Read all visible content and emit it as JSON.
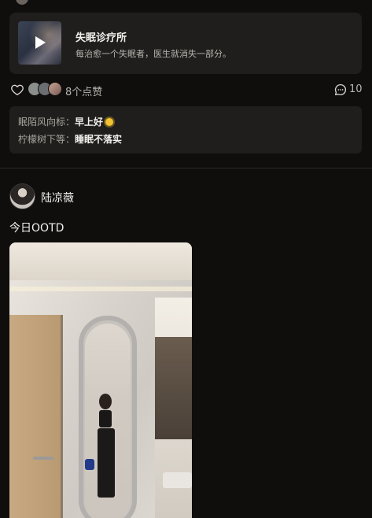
{
  "music_card": {
    "title": "失眠诊疗所",
    "description": "每治愈一个失眠者，医生就消失一部分。"
  },
  "actions": {
    "like_count_label": "8个点赞",
    "comment_count": "10"
  },
  "comments": [
    {
      "author": "眠陌风向标：",
      "text": "早上好"
    },
    {
      "author": "柠檬树下等：",
      "text": "睡眠不落实"
    }
  ],
  "post": {
    "username": "陆凉薇",
    "caption": "今日OOTD"
  },
  "icons": {
    "heart": "heart-outline-icon",
    "comment": "comment-bubble-icon",
    "play": "play-icon",
    "sun": "sun-emoji-icon"
  },
  "colors": {
    "background": "#0f0e0d",
    "card": "#1f1e1c",
    "primary_text": "#f2f0ed",
    "secondary_text": "#b9b5b0"
  }
}
